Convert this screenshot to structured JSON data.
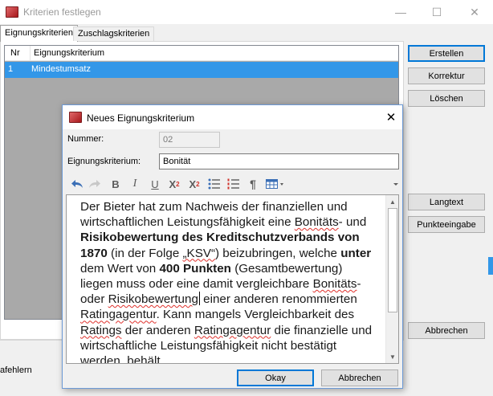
{
  "main_window": {
    "title": "Kriterien festlegen",
    "minimize_glyph": "—",
    "maximize_glyph": "☐",
    "close_glyph": "✕"
  },
  "tabs": [
    {
      "label": "Eignungskriterien",
      "active": true
    },
    {
      "label": "Zuschlagskriterien",
      "active": false
    }
  ],
  "list": {
    "columns": [
      "Nr",
      "Eignungskriterium"
    ],
    "rows": [
      {
        "nr": "1",
        "kriterium": "Mindestumsatz",
        "selected": true
      }
    ]
  },
  "side_buttons": {
    "erstellen": "Erstellen",
    "korrektur": "Korrektur",
    "loeschen": "Löschen",
    "langtext": "Langtext",
    "punkteeingabe": "Punkteeingabe",
    "abbrechen": "Abbrechen"
  },
  "status_fragment": "afehlern",
  "dialog": {
    "title": "Neues Eignungskriterium",
    "close_glyph": "✕",
    "nummer_label": "Nummer:",
    "nummer_value": "02",
    "kriterium_label": "Eignungskriterium:",
    "kriterium_value": "Bonität",
    "editor": {
      "t1": "Der Bieter hat zum Nachweis der finanziellen und wirtschaftlichen Leistungsfähigkeit eine ",
      "w1": "Bonitäts",
      "t2": "- und ",
      "b1": "Risikobewertung des Kreditschutzverbands von 1870",
      "t3": " (in der Folge ",
      "w2": "„KSV“",
      "t4": ") beizubringen, welche ",
      "b2": "unter",
      "t5": " dem Wert von ",
      "b3": "400 Punkten",
      "t6": " (Gesamtbewertung) liegen muss oder eine damit vergleichbare ",
      "w3": "Bonitäts",
      "t7": "- oder ",
      "w4": "Risikobewertung",
      "t8": " einer anderen renommierten ",
      "w5": "Ratingagentur",
      "t9": ". Kann mangels Vergleichbarkeit des ",
      "w6": "Ratings",
      "t10": " der anderen ",
      "w7": "Ratingagentur",
      "t11": " die finanzielle und wirtschaftliche Leistungsfähigkeit nicht bestätigt werden, behält"
    },
    "buttons": {
      "okay": "Okay",
      "abbrechen": "Abbrechen"
    }
  },
  "icons": {
    "undo": "undo-icon",
    "redo": "redo-icon",
    "bold": "B",
    "italic": "I",
    "underline": "U",
    "superscript_base": "X",
    "superscript_mark": "2",
    "subscript_base": "X",
    "subscript_mark": "2",
    "paragraph": "¶",
    "scroll_up": "▲",
    "scroll_down": "▼"
  },
  "colors": {
    "selection": "#3397e8",
    "accent_border": "#0078d7",
    "spellcheck": "#e0302b"
  }
}
